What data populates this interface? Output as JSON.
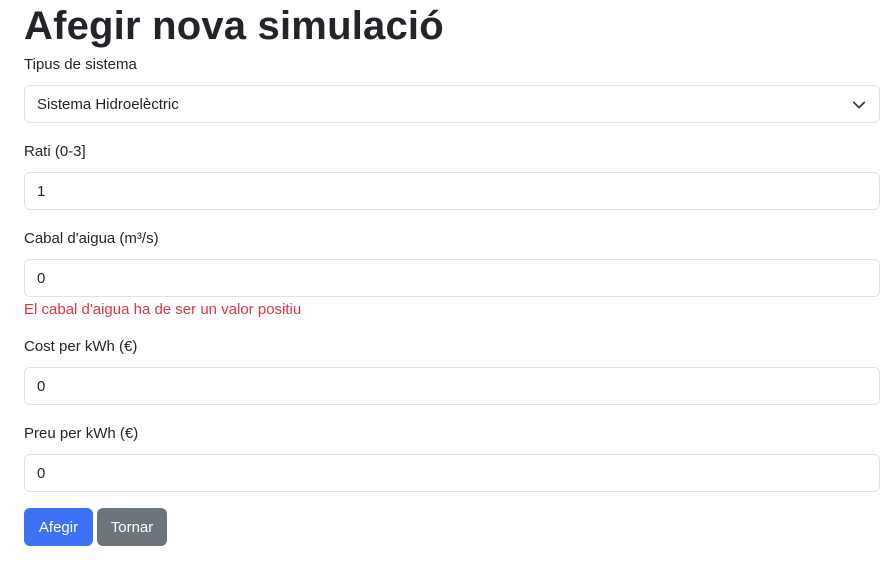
{
  "page": {
    "title": "Afegir nova simulació"
  },
  "form": {
    "system_type": {
      "label": "Tipus de sistema",
      "value": "Sistema Hidroelèctric"
    },
    "rati": {
      "label": "Rati (0-3]",
      "value": "1"
    },
    "cabal": {
      "label": "Cabal d'aigua (m³/s)",
      "value": "0",
      "error": "El cabal d'aigua ha de ser un valor positiu"
    },
    "cost": {
      "label": "Cost per kWh (€)",
      "value": "0"
    },
    "preu": {
      "label": "Preu per kWh (€)",
      "value": "0"
    }
  },
  "actions": {
    "add_label": "Afegir",
    "back_label": "Tornar"
  },
  "colors": {
    "primary": "#3d72f5",
    "secondary": "#6c757d",
    "error": "#dc3545",
    "border": "#dee2e6"
  },
  "icons": {
    "select_indicator": "chevron-down-icon"
  }
}
